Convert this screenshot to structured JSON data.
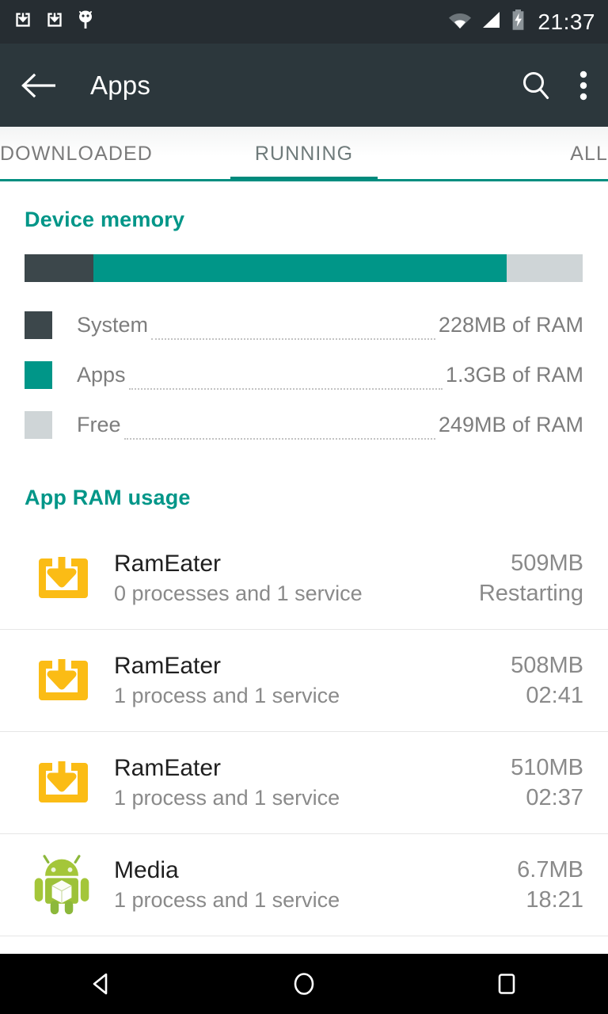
{
  "statusbar": {
    "icons": [
      "download-icon",
      "download-icon",
      "android-debug-icon",
      "wifi-icon",
      "signal-icon",
      "battery-charging-icon"
    ],
    "clock": "21:37"
  },
  "appbar": {
    "back_label": "back-arrow",
    "title": "Apps",
    "search_label": "search-icon",
    "overflow_label": "more-options-icon"
  },
  "tabs": [
    {
      "label": "DOWNLOADED",
      "active": false
    },
    {
      "label": "RUNNING",
      "active": true
    },
    {
      "label": "ALL",
      "active": false
    }
  ],
  "device_memory": {
    "header": "Device memory",
    "legend": [
      {
        "label": "System",
        "value": "228MB of RAM",
        "color": "#3c474b"
      },
      {
        "label": "Apps",
        "value": "1.3GB of RAM",
        "color": "#009688"
      },
      {
        "label": "Free",
        "value": "249MB of RAM",
        "color": "#cfd5d7"
      }
    ]
  },
  "app_ram_usage": {
    "header": "App RAM usage",
    "rows": [
      {
        "name": "RamEater",
        "sub": "0 processes and 1 service",
        "size": "509MB",
        "time": "Restarting",
        "icon": "rameater-icon"
      },
      {
        "name": "RamEater",
        "sub": "1 process and 1 service",
        "size": "508MB",
        "time": "02:41",
        "icon": "rameater-icon"
      },
      {
        "name": "RamEater",
        "sub": "1 process and 1 service",
        "size": "510MB",
        "time": "02:37",
        "icon": "rameater-icon"
      },
      {
        "name": "Media",
        "sub": "1 process and 1 service",
        "size": "6.7MB",
        "time": "18:21",
        "icon": "android-robot-icon"
      }
    ]
  },
  "navbar": {
    "back": "back-triangle-icon",
    "home": "home-circle-icon",
    "recents": "recents-square-icon"
  },
  "colors": {
    "accent_teal": "#009688",
    "statusbar_bg": "#262d32",
    "appbar_bg": "#2c373c",
    "system_segment": "#3c474b",
    "free_segment": "#cfd5d7",
    "app_icon_amber": "#fbbc15",
    "android_green": "#a4c639"
  },
  "chart_data": {
    "type": "bar",
    "title": "Device memory",
    "categories": [
      "System",
      "Apps",
      "Free"
    ],
    "values": [
      228,
      1300,
      249
    ],
    "value_labels": [
      "228MB of RAM",
      "1.3GB of RAM",
      "249MB of RAM"
    ],
    "unit": "MB",
    "colors": [
      "#3c474b",
      "#009688",
      "#cfd5d7"
    ],
    "percentages": [
      12.4,
      71.0,
      13.6
    ],
    "stacked": true,
    "orientation": "horizontal",
    "legend": "below",
    "grid": false
  }
}
